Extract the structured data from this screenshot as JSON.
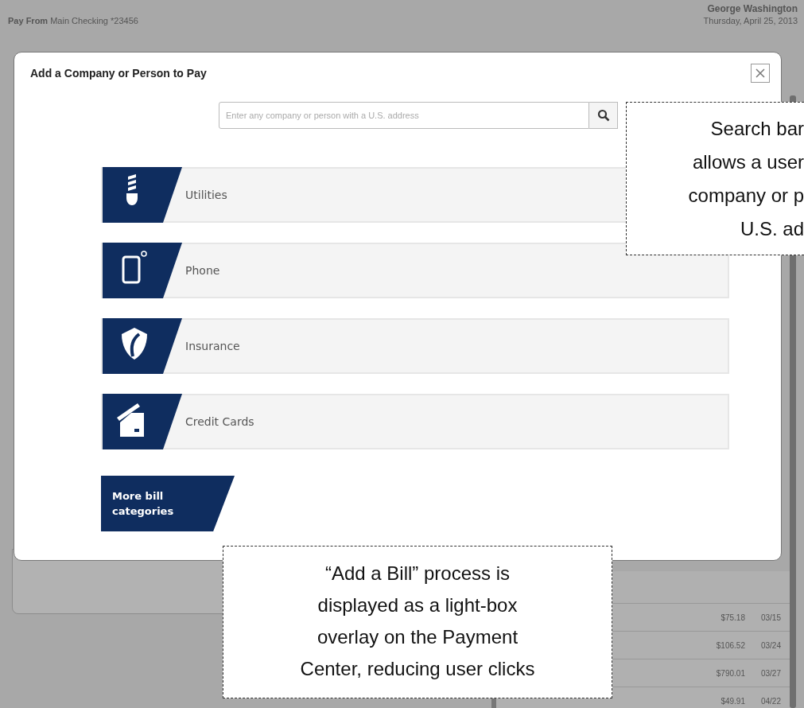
{
  "page": {
    "pay_from": {
      "label": "Pay From",
      "value": "Main Checking *23456"
    },
    "user_name": "George Washington",
    "date": "Thursday, April 25, 2013",
    "payments": [
      {
        "amount": "$75.18",
        "date": "03/15"
      },
      {
        "amount": "$106.52",
        "date": "03/24"
      },
      {
        "amount": "$790.01",
        "date": "03/27"
      },
      {
        "amount": "$49.91",
        "date": "04/22"
      }
    ]
  },
  "dialog": {
    "title": "Add a Company or Person to Pay",
    "search": {
      "placeholder": "Enter any company or person with a U.S. address"
    },
    "categories": [
      {
        "label": "Utilities",
        "kind": "bulb"
      },
      {
        "label": "Phone",
        "kind": "tablet"
      },
      {
        "label": "Insurance",
        "kind": "shield"
      },
      {
        "label": "Credit Cards",
        "kind": "card"
      }
    ],
    "more_button": "More bill categories"
  },
  "annotations": {
    "search_note": [
      "Search bar",
      "allows a user",
      "company or p",
      "U.S. ad"
    ],
    "overlay_note": [
      "“Add a Bill” process is",
      "displayed as a light-box",
      "overlay on the Payment",
      "Center, reducing user clicks"
    ]
  }
}
